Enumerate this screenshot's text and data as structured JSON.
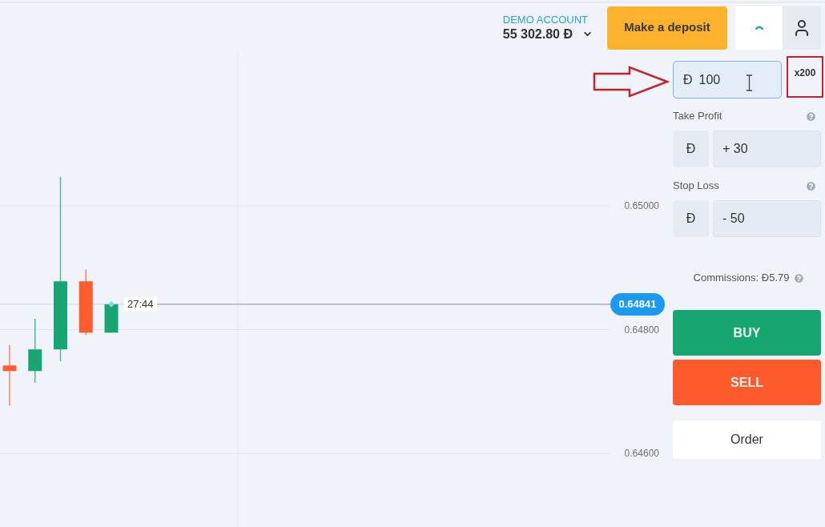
{
  "header": {
    "account_type": "DEMO ACCOUNT",
    "balance": "55 302.80 Đ",
    "deposit_button": "Make a deposit"
  },
  "chart": {
    "timer": "27:44",
    "price_badge": "0.64841",
    "axis_labels": [
      "0.65000",
      "0.64800",
      "0.64600"
    ]
  },
  "order_panel": {
    "amount": {
      "currency": "Đ",
      "value": "100"
    },
    "leverage": "x200",
    "take_profit": {
      "label": "Take Profit",
      "currency": "Đ",
      "value": "+ 30"
    },
    "stop_loss": {
      "label": "Stop Loss",
      "currency": "Đ",
      "value": "- 50"
    },
    "commissions": "Commissions: Đ5.79",
    "buttons": [
      {
        "label": "BUY",
        "kind": "buy"
      },
      {
        "label": "SELL",
        "kind": "sell"
      },
      {
        "label": "Order",
        "kind": "order"
      }
    ]
  },
  "annotations": {
    "arrow": true,
    "highlight_box": true
  }
}
